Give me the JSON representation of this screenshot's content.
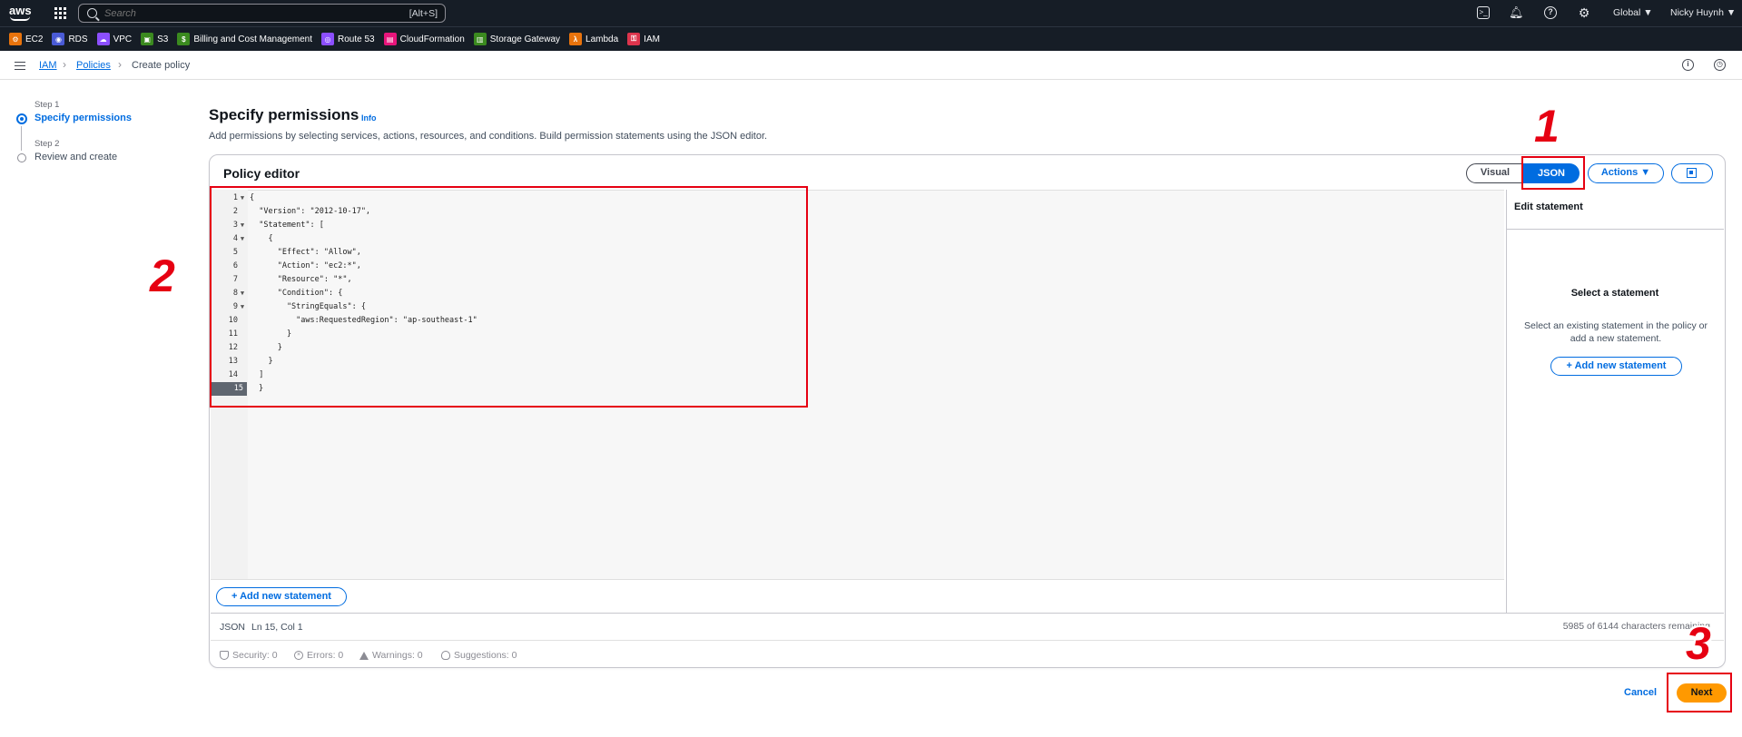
{
  "topnav": {
    "logo": "aws",
    "search_placeholder": "Search",
    "search_shortcut": "[Alt+S]",
    "region": "Global ▼",
    "user": "Nicky Huynh ▼"
  },
  "services": [
    {
      "label": "EC2",
      "color": "#e8730c",
      "glyph": "⚙"
    },
    {
      "label": "RDS",
      "color": "#4a5bd6",
      "glyph": "◉"
    },
    {
      "label": "VPC",
      "color": "#8c4fff",
      "glyph": "☁"
    },
    {
      "label": "S3",
      "color": "#3b8a1f",
      "glyph": "▣"
    },
    {
      "label": "Billing and Cost Management",
      "color": "#3b8a1f",
      "glyph": "$"
    },
    {
      "label": "Route 53",
      "color": "#8c4fff",
      "glyph": "◎"
    },
    {
      "label": "CloudFormation",
      "color": "#e7157b",
      "glyph": "▤"
    },
    {
      "label": "Storage Gateway",
      "color": "#3b8a1f",
      "glyph": "▥"
    },
    {
      "label": "Lambda",
      "color": "#e8730c",
      "glyph": "λ"
    },
    {
      "label": "IAM",
      "color": "#dd344c",
      "glyph": "⚿"
    }
  ],
  "breadcrumb": {
    "iam": "IAM",
    "policies": "Policies",
    "current": "Create policy",
    "sep": "›"
  },
  "wizard": {
    "step1_label": "Step 1",
    "step1_title": "Specify permissions",
    "step2_label": "Step 2",
    "step2_title": "Review and create"
  },
  "header": {
    "title": "Specify permissions",
    "info": "Info",
    "description": "Add permissions by selecting services, actions, resources, and conditions. Build permission statements using the JSON editor."
  },
  "editor": {
    "title": "Policy editor",
    "visual_label": "Visual",
    "json_label": "JSON",
    "actions_label": "Actions ▼",
    "code_lines": [
      {
        "n": "1",
        "fold": "▼",
        "text": "{"
      },
      {
        "n": "2",
        "fold": "",
        "text": "  \"Version\": \"2012-10-17\","
      },
      {
        "n": "3",
        "fold": "▼",
        "text": "  \"Statement\": ["
      },
      {
        "n": "4",
        "fold": "▼",
        "text": "    {"
      },
      {
        "n": "5",
        "fold": "",
        "text": "      \"Effect\": \"Allow\","
      },
      {
        "n": "6",
        "fold": "",
        "text": "      \"Action\": \"ec2:*\","
      },
      {
        "n": "7",
        "fold": "",
        "text": "      \"Resource\": \"*\","
      },
      {
        "n": "8",
        "fold": "▼",
        "text": "      \"Condition\": {"
      },
      {
        "n": "9",
        "fold": "▼",
        "text": "        \"StringEquals\": {"
      },
      {
        "n": "10",
        "fold": "",
        "text": "          \"aws:RequestedRegion\": \"ap-southeast-1\""
      },
      {
        "n": "11",
        "fold": "",
        "text": "        }"
      },
      {
        "n": "12",
        "fold": "",
        "text": "      }"
      },
      {
        "n": "13",
        "fold": "",
        "text": "    }"
      },
      {
        "n": "14",
        "fold": "",
        "text": "  ]"
      },
      {
        "n": "15",
        "fold": "",
        "text": "}"
      }
    ],
    "add_statement_label": "+  Add new statement",
    "status_lang": "JSON",
    "status_pos": "Ln 15, Col 1",
    "status_chars": "5985 of 6144 characters remaining",
    "lint": {
      "security": "Security: 0",
      "errors": "Errors: 0",
      "warnings": "Warnings: 0",
      "suggestions": "Suggestions: 0"
    }
  },
  "side_panel": {
    "title": "Edit statement",
    "heading": "Select a statement",
    "text": "Select an existing statement in the policy or add a new statement.",
    "add_label": "+  Add new statement"
  },
  "footer": {
    "cancel": "Cancel",
    "next": "Next"
  },
  "annotations": {
    "one": "1",
    "two": "2",
    "three": "3"
  }
}
